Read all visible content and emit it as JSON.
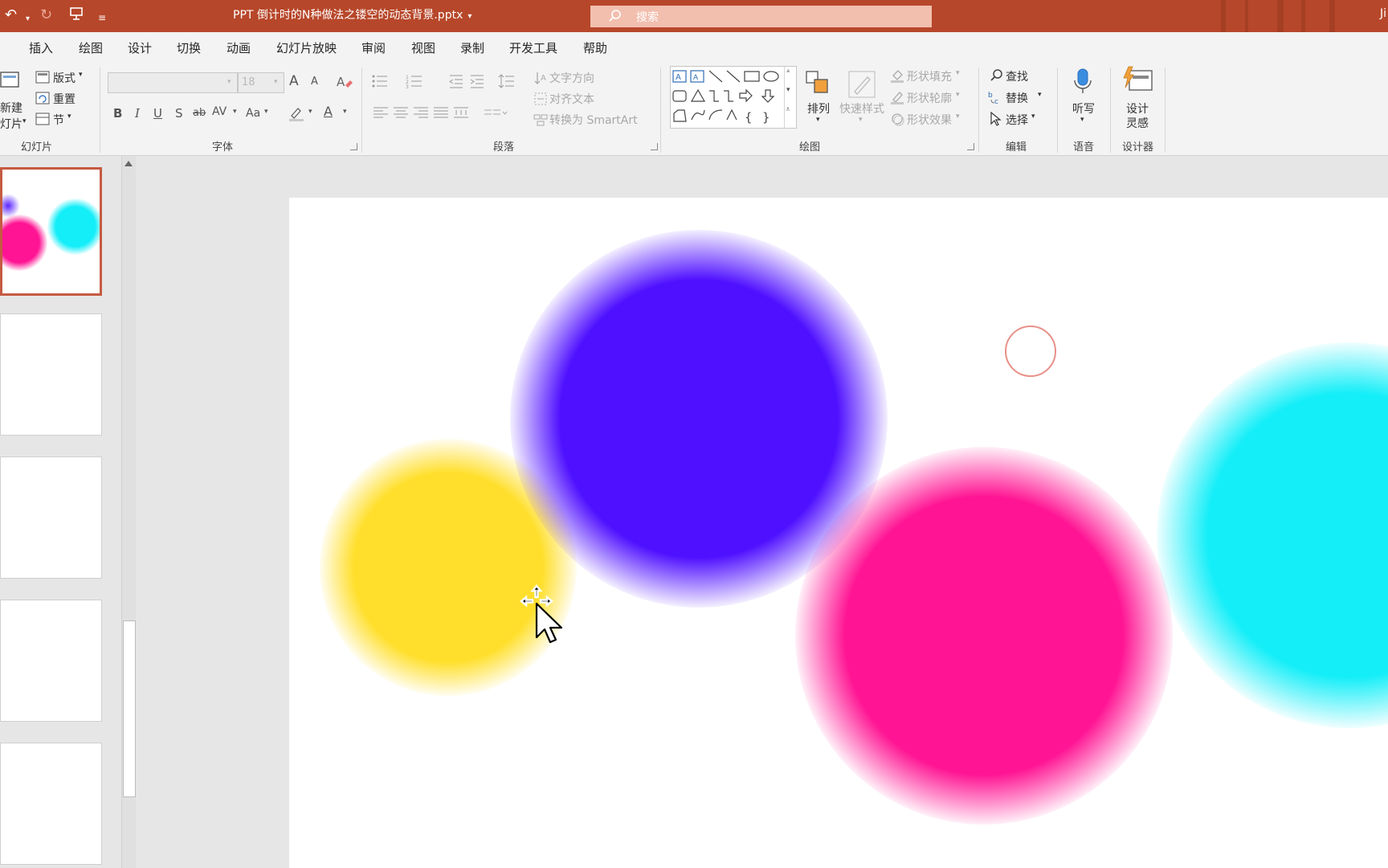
{
  "titlebar": {
    "document_title": "PPT 倒计时的N种做法之镂空的动态背景.pptx",
    "search_placeholder": "搜索",
    "user_initial": "Ji"
  },
  "tabs": [
    "插入",
    "绘图",
    "设计",
    "切换",
    "动画",
    "幻灯片放映",
    "审阅",
    "视图",
    "录制",
    "开发工具",
    "帮助"
  ],
  "ribbon": {
    "slides": {
      "group_label": "幻灯片",
      "new_slide_line1": "新建",
      "new_slide_line2": "灯片",
      "layout": "版式",
      "reset": "重置",
      "section": "节"
    },
    "font": {
      "group_label": "字体",
      "font_name": "",
      "font_size": "18",
      "bold": "B",
      "italic": "I",
      "underline": "U",
      "shadow": "S",
      "strike": "ab",
      "spacing": "AV",
      "case": "Aa",
      "grow": "A",
      "shrink": "A",
      "font_color": "A"
    },
    "paragraph": {
      "group_label": "段落",
      "text_direction": "文字方向",
      "align_text": "对齐文本",
      "convert_smartart": "转换为 SmartArt"
    },
    "drawing": {
      "group_label": "绘图",
      "arrange": "排列",
      "quick_styles": "快速样式",
      "shape_fill": "形状填充",
      "shape_outline": "形状轮廓",
      "shape_effects": "形状效果"
    },
    "editing": {
      "group_label": "编辑",
      "find": "查找",
      "replace": "替换",
      "select": "选择"
    },
    "voice": {
      "group_label": "语音",
      "dictate": "听写"
    },
    "designer": {
      "group_label": "设计器",
      "ideas_line1": "设计",
      "ideas_line2": "灵感"
    }
  },
  "colors": {
    "accent": "#b7472a",
    "yellow": "#ffdf2c",
    "purple": "#4f10ff",
    "pink": "#ff1493",
    "cyan": "#14eef8"
  },
  "thumbnails_count": 5
}
